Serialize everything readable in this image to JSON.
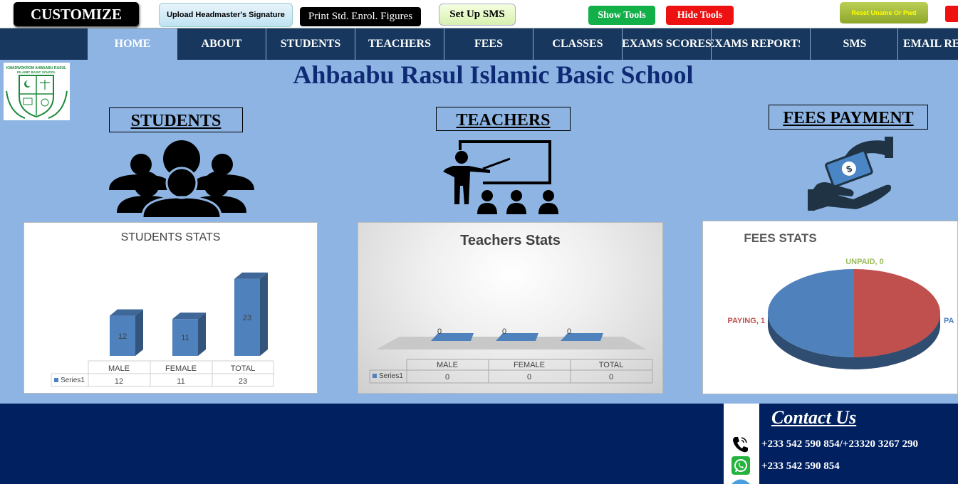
{
  "toolbar": {
    "customize": "CUSTOMIZE",
    "upload_signature": "Upload Headmaster's Signature",
    "print_enrol": "Print Std. Enrol. Figures",
    "setup_sms": "Set Up SMS",
    "show_tools": "Show Tools",
    "hide_tools": "Hide Tools",
    "reset_uname": "Reset Uname Or Pwd"
  },
  "nav": {
    "items": [
      "HOME",
      "ABOUT",
      "STUDENTS",
      "TEACHERS",
      "FEES",
      "CLASSES",
      "EXAMS SCORES",
      "EXAMS REPORTS",
      "SMS",
      "EMAIL RE"
    ],
    "active": "HOME"
  },
  "header": {
    "school_name": "Ahbaabu Rasul Islamic Basic School",
    "logo_text_top": "KWADWOKROM AHBAABU RASUL",
    "logo_text_mid": "ISLAMIC BASIC SCHOOL"
  },
  "sections": {
    "students": "STUDENTS",
    "teachers": "TEACHERS",
    "fees": "FEES PAYMENT"
  },
  "chart_data": [
    {
      "type": "bar",
      "title": "STUDENTS STATS",
      "categories": [
        "MALE",
        "FEMALE",
        "TOTAL"
      ],
      "series": [
        {
          "name": "Series1",
          "values": [
            12,
            11,
            23
          ]
        }
      ],
      "color": "#4f81bd",
      "table": true
    },
    {
      "type": "bar",
      "title": "Teachers Stats",
      "categories": [
        "MALE",
        "FEMALE",
        "TOTAL"
      ],
      "series": [
        {
          "name": "Series1",
          "values": [
            0,
            0,
            0
          ]
        }
      ],
      "color": "#4f81bd",
      "table": true
    },
    {
      "type": "pie",
      "title": "FEES STATS",
      "labels": [
        "UNPAID",
        "PAYING",
        "PAID"
      ],
      "values": [
        0,
        1,
        1
      ],
      "data_labels": [
        "UNPAID, 0",
        "PAYING, 1",
        "PA"
      ],
      "colors": [
        "#9bbb59",
        "#c0504d",
        "#4f81bd"
      ]
    }
  ],
  "contact": {
    "title": "Contact Us",
    "phone": "+233 542 590 854/+23320 3267 290",
    "whatsapp": "+233 542 590 854"
  },
  "colors": {
    "background": "#8db4e2",
    "navbar": "#17375e",
    "footer": "#002060",
    "title": "#0f2a74"
  }
}
